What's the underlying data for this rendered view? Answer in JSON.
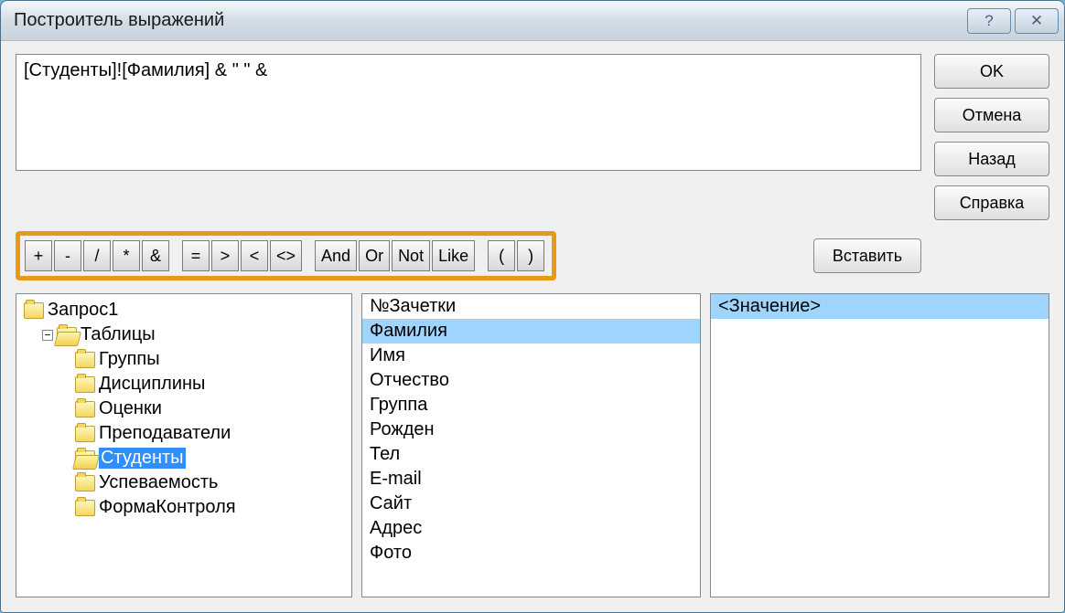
{
  "window": {
    "title": "Построитель выражений",
    "help_glyph": "?",
    "close_glyph": "✕"
  },
  "expression": "[Студенты]![Фамилия] & \" \" & ",
  "buttons": {
    "ok": "OK",
    "cancel": "Отмена",
    "back": "Назад",
    "help": "Справка",
    "insert": "Вставить"
  },
  "operators": {
    "plus": "+",
    "minus": "-",
    "div": "/",
    "mul": "*",
    "amp": "&",
    "eq": "=",
    "gt": ">",
    "lt": "<",
    "ne": "<>",
    "and": "And",
    "or": "Or",
    "not": "Not",
    "like": "Like",
    "lparen": "(",
    "rparen": ")"
  },
  "tree": {
    "root": "Запрос1",
    "tables_label": "Таблицы",
    "expander_minus": "−",
    "items": [
      "Группы",
      "Дисциплины",
      "Оценки",
      "Преподаватели",
      "Студенты",
      "Успеваемость",
      "ФормаКонтроля"
    ],
    "selected": "Студенты"
  },
  "fields": {
    "items": [
      "№Зачетки",
      "Фамилия",
      "Имя",
      "Отчество",
      "Группа",
      "Рожден",
      "Тел",
      "E-mail",
      "Сайт",
      "Адрес",
      "Фото"
    ],
    "selected": "Фамилия"
  },
  "values": {
    "items": [
      "<Значение>"
    ],
    "selected": "<Значение>"
  }
}
